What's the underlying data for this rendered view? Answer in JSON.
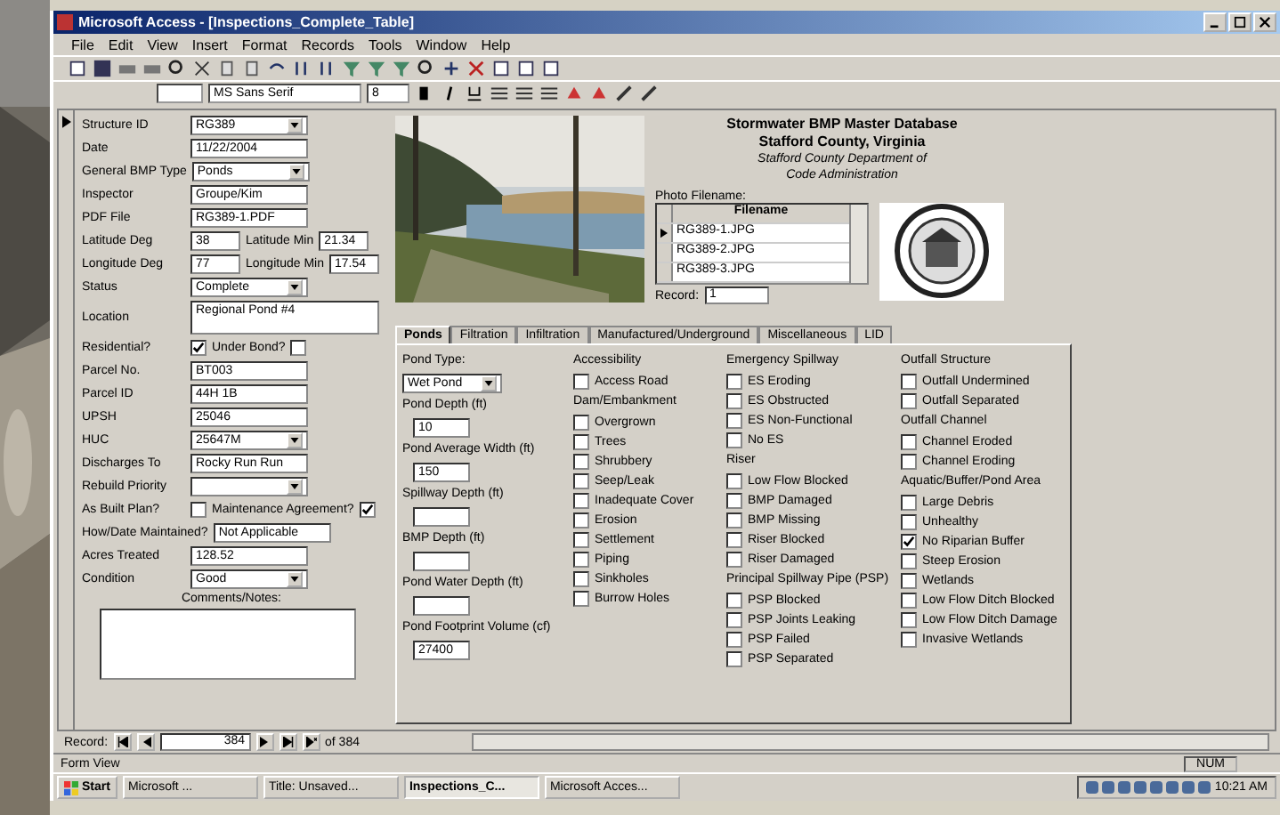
{
  "window": {
    "title": "Microsoft Access - [Inspections_Complete_Table]"
  },
  "menu": [
    "File",
    "Edit",
    "View",
    "Insert",
    "Format",
    "Records",
    "Tools",
    "Window",
    "Help"
  ],
  "format_bar": {
    "font": "MS Sans Serif",
    "size": "8"
  },
  "fields": [
    [
      {
        "kind": "select",
        "label": "Structure ID",
        "value": "RG389"
      }
    ],
    [
      {
        "kind": "text",
        "label": "Date",
        "value": "11/22/2004"
      }
    ],
    [
      {
        "kind": "select",
        "label": "General BMP Type",
        "value": "Ponds"
      }
    ],
    [
      {
        "kind": "text",
        "label": "Inspector",
        "value": "Groupe/Kim"
      }
    ],
    [
      {
        "kind": "text",
        "label": "PDF File",
        "value": "RG389-1.PDF"
      }
    ],
    [
      {
        "kind": "text",
        "label": "Latitude Deg",
        "value": "38"
      },
      {
        "kind": "text",
        "label": "Latitude Min",
        "value": "21.34"
      }
    ],
    [
      {
        "kind": "text",
        "label": "Longitude Deg",
        "value": "77"
      },
      {
        "kind": "text",
        "label": "Longitude Min",
        "value": "17.54"
      }
    ],
    [
      {
        "kind": "select",
        "label": "Status",
        "value": "Complete"
      }
    ],
    [
      {
        "kind": "area",
        "label": "Location",
        "value": "Regional Pond #4"
      }
    ],
    [
      {
        "kind": "check",
        "label": "Residential?",
        "checked": true
      },
      {
        "kind": "check",
        "label": "Under Bond?",
        "checked": false
      }
    ],
    [
      {
        "kind": "text",
        "label": "Parcel No.",
        "value": "BT003"
      }
    ],
    [
      {
        "kind": "text",
        "label": "Parcel ID",
        "value": "44H  1B"
      }
    ],
    [
      {
        "kind": "text",
        "label": "UPSH",
        "value": "25046"
      }
    ],
    [
      {
        "kind": "select",
        "label": "HUC",
        "value": "25647M"
      }
    ],
    [
      {
        "kind": "text",
        "label": "Discharges To",
        "value": "Rocky Run Run"
      }
    ],
    [
      {
        "kind": "select",
        "label": "Rebuild Priority"
      }
    ],
    [
      {
        "kind": "check",
        "label": "As Built Plan?",
        "checked": false
      },
      {
        "kind": "check",
        "label": "Maintenance Agreement?",
        "checked": true
      }
    ],
    [
      {
        "kind": "text",
        "label": "How/Date Maintained?",
        "value": "Not Applicable"
      }
    ],
    [
      {
        "kind": "text",
        "label": "Acres Treated",
        "value": "128.52"
      }
    ],
    [
      {
        "kind": "select",
        "label": "Condition",
        "value": "Good"
      }
    ]
  ],
  "comments": {
    "label": "Comments/Notes:"
  },
  "header": {
    "title_lines": [
      "Stormwater BMP Master Database",
      "Stafford County, Virginia"
    ],
    "dept_lines": [
      "Stafford County Department of",
      "Code Administration"
    ]
  },
  "photos": {
    "label": "Photo Filename:",
    "column": "Filename",
    "rows": [
      {
        "name": "RG389-1.JPG",
        "selected": true
      },
      {
        "name": "RG389-2.JPG",
        "selected": false
      },
      {
        "name": "RG389-3.JPG",
        "selected": false
      }
    ],
    "nav_label": "Record:",
    "nav_value": "1"
  },
  "tabs": [
    {
      "label": "Ponds",
      "selected": true
    },
    {
      "label": "Filtration",
      "selected": false
    },
    {
      "label": "Infiltration",
      "selected": false
    },
    {
      "label": "Manufactured/Underground",
      "selected": false
    },
    {
      "label": "Miscellaneous",
      "selected": false
    },
    {
      "label": "LID",
      "selected": false
    }
  ],
  "pond_columns": [
    [
      {
        "kind": "heading",
        "label": "Pond Type:"
      },
      {
        "kind": "select",
        "value": "Wet Pond"
      },
      {
        "kind": "heading",
        "label": "Pond Depth (ft)"
      },
      {
        "kind": "text",
        "value": "10"
      },
      {
        "kind": "heading",
        "label": "Pond Average Width (ft)"
      },
      {
        "kind": "text",
        "value": "150"
      },
      {
        "kind": "heading",
        "label": "Spillway Depth (ft)"
      },
      {
        "kind": "text"
      },
      {
        "kind": "heading",
        "label": "BMP Depth (ft)"
      },
      {
        "kind": "text"
      },
      {
        "kind": "heading",
        "label": "Pond Water Depth (ft)"
      },
      {
        "kind": "text"
      },
      {
        "kind": "heading",
        "label": "Pond Footprint Volume (cf)"
      },
      {
        "kind": "text",
        "value": "27400"
      }
    ],
    [
      {
        "kind": "heading",
        "label": "Accessibility"
      },
      {
        "kind": "check",
        "label": "Access Road",
        "checked": false
      },
      {
        "kind": "heading",
        "label": "Dam/Embankment"
      },
      {
        "kind": "check",
        "label": "Overgrown",
        "checked": false
      },
      {
        "kind": "check",
        "label": "Trees",
        "checked": false
      },
      {
        "kind": "check",
        "label": "Shrubbery",
        "checked": false
      },
      {
        "kind": "check",
        "label": "Seep/Leak",
        "checked": false
      },
      {
        "kind": "check",
        "label": "Inadequate Cover",
        "checked": false
      },
      {
        "kind": "check",
        "label": "Erosion",
        "checked": false
      },
      {
        "kind": "check",
        "label": "Settlement",
        "checked": false
      },
      {
        "kind": "check",
        "label": "Piping",
        "checked": false
      },
      {
        "kind": "check",
        "label": "Sinkholes",
        "checked": false
      },
      {
        "kind": "check",
        "label": "Burrow Holes",
        "checked": false
      }
    ],
    [
      {
        "kind": "heading",
        "label": "Emergency Spillway"
      },
      {
        "kind": "check",
        "label": "ES Eroding",
        "checked": false
      },
      {
        "kind": "check",
        "label": "ES Obstructed",
        "checked": false
      },
      {
        "kind": "check",
        "label": "ES Non-Functional",
        "checked": false
      },
      {
        "kind": "check",
        "label": "No ES",
        "checked": false
      },
      {
        "kind": "heading",
        "label": "Riser"
      },
      {
        "kind": "check",
        "label": "Low Flow Blocked",
        "checked": false
      },
      {
        "kind": "check",
        "label": "BMP Damaged",
        "checked": false
      },
      {
        "kind": "check",
        "label": "BMP Missing",
        "checked": false
      },
      {
        "kind": "check",
        "label": "Riser Blocked",
        "checked": false
      },
      {
        "kind": "check",
        "label": "Riser Damaged",
        "checked": false
      },
      {
        "kind": "heading",
        "label": "Principal Spillway Pipe (PSP)"
      },
      {
        "kind": "check",
        "label": "PSP Blocked",
        "checked": false
      },
      {
        "kind": "check",
        "label": "PSP Joints Leaking",
        "checked": false
      },
      {
        "kind": "check",
        "label": "PSP Failed",
        "checked": false
      },
      {
        "kind": "check",
        "label": "PSP Separated",
        "checked": false
      }
    ],
    [
      {
        "kind": "heading",
        "label": "Outfall Structure"
      },
      {
        "kind": "check",
        "label": "Outfall Undermined",
        "checked": false
      },
      {
        "kind": "check",
        "label": "Outfall Separated",
        "checked": false
      },
      {
        "kind": "heading",
        "label": "Outfall Channel"
      },
      {
        "kind": "check",
        "label": "Channel Eroded",
        "checked": false
      },
      {
        "kind": "check",
        "label": "Channel Eroding",
        "checked": false
      },
      {
        "kind": "heading",
        "label": "Aquatic/Buffer/Pond Area"
      },
      {
        "kind": "check",
        "label": "Large Debris",
        "checked": false
      },
      {
        "kind": "check",
        "label": "Unhealthy",
        "checked": false
      },
      {
        "kind": "check",
        "label": "No Riparian Buffer",
        "checked": true
      },
      {
        "kind": "check",
        "label": "Steep Erosion",
        "checked": false
      },
      {
        "kind": "check",
        "label": "Wetlands",
        "checked": false
      },
      {
        "kind": "check",
        "label": "Low Flow Ditch Blocked",
        "checked": false
      },
      {
        "kind": "check",
        "label": "Low Flow Ditch Damage",
        "checked": false
      },
      {
        "kind": "check",
        "label": "Invasive Wetlands",
        "checked": false
      }
    ]
  ],
  "record_nav": {
    "label": "Record:",
    "value": "384",
    "total": "of 384"
  },
  "status_bar": {
    "left": "Form View",
    "right": "NUM"
  },
  "taskbar": {
    "start": "Start",
    "tasks": [
      {
        "label": "Microsoft ...",
        "selected": false
      },
      {
        "label": "Title: Unsaved...",
        "selected": false
      },
      {
        "label": "Inspections_C...",
        "selected": true
      },
      {
        "label": "Microsoft Acces...",
        "selected": false
      }
    ],
    "clock": "10:21 AM"
  }
}
